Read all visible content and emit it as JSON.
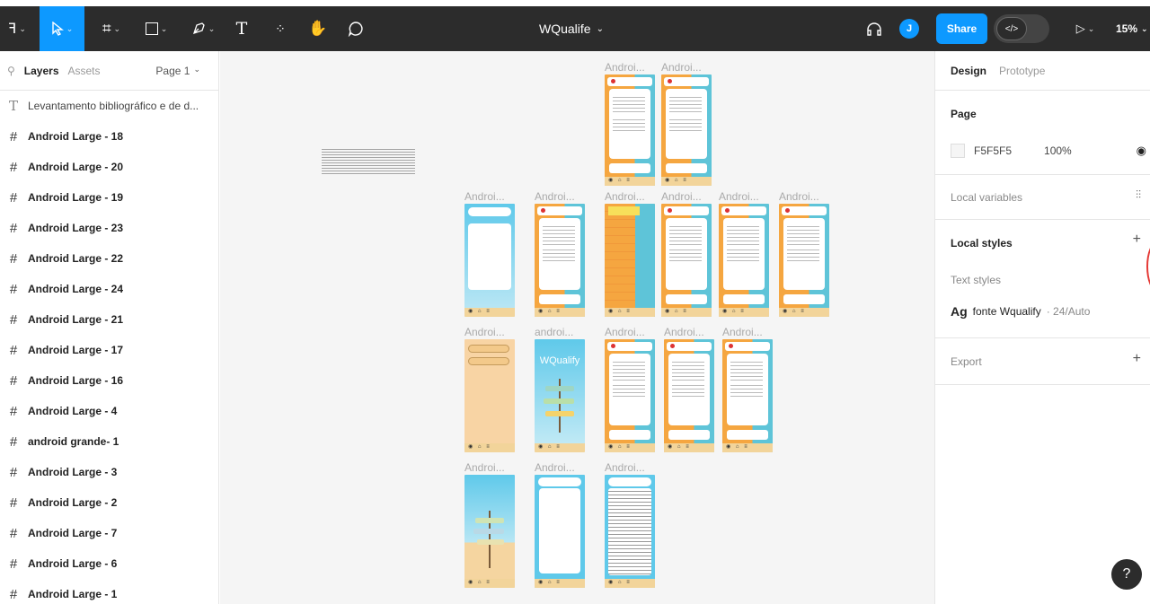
{
  "toolbar": {
    "title": "WQualife",
    "share_label": "Share",
    "zoom_label": "15%",
    "avatar_initial": "J",
    "tools": [
      "main-menu",
      "move",
      "frame",
      "shape",
      "pen",
      "text",
      "components",
      "hand",
      "comment"
    ]
  },
  "left_panel": {
    "tab_layers": "Layers",
    "tab_assets": "Assets",
    "page_select": "Page 1",
    "layers": [
      {
        "type": "text",
        "name": "Levantamento bibliográfico e de d..."
      },
      {
        "type": "frame",
        "name": "Android Large - 18"
      },
      {
        "type": "frame",
        "name": "Android Large - 20"
      },
      {
        "type": "frame",
        "name": "Android Large - 19"
      },
      {
        "type": "frame",
        "name": "Android Large - 23"
      },
      {
        "type": "frame",
        "name": "Android Large - 22"
      },
      {
        "type": "frame",
        "name": "Android Large - 24"
      },
      {
        "type": "frame",
        "name": "Android Large - 21"
      },
      {
        "type": "frame",
        "name": "Android Large - 17"
      },
      {
        "type": "frame",
        "name": "Android Large - 16"
      },
      {
        "type": "frame",
        "name": "Android Large - 4"
      },
      {
        "type": "frame",
        "name": "android grande- 1"
      },
      {
        "type": "frame",
        "name": "Android Large - 3"
      },
      {
        "type": "frame",
        "name": "Android Large - 2"
      },
      {
        "type": "frame",
        "name": "Android Large - 7"
      },
      {
        "type": "frame",
        "name": "Android Large - 6"
      },
      {
        "type": "frame",
        "name": "Android Large - 1"
      }
    ]
  },
  "canvas": {
    "frame_labels": {
      "androi": "Androi...",
      "androi_lower": "androi..."
    },
    "wqualify_text": "WQualify"
  },
  "right_panel": {
    "tab_design": "Design",
    "tab_prototype": "Prototype",
    "page_heading": "Page",
    "page_color": "F5F5F5",
    "page_opacity": "100%",
    "local_variables": "Local variables",
    "local_styles": "Local styles",
    "text_styles": "Text styles",
    "style_glyph": "Ag",
    "style_name": "fonte Wqualify",
    "style_meta": "· 24/Auto",
    "export": "Export"
  },
  "colors": {
    "toolbar_bg": "#2c2c2c",
    "accent": "#0d99ff",
    "canvas_bg": "#f5f5f5",
    "frame_orange": "#f5a640",
    "frame_teal": "#5ec4d8"
  }
}
